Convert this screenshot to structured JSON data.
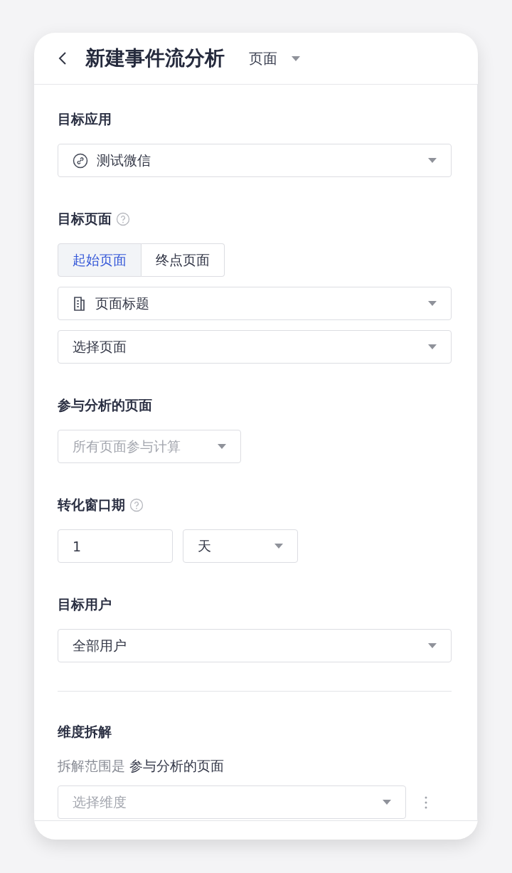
{
  "header": {
    "title": "新建事件流分析",
    "mode": "页面"
  },
  "sections": [
    {
      "label": "目标应用",
      "help": false,
      "rows": [
        [
          {
            "kind": "app",
            "value": "测试微信"
          }
        ]
      ]
    },
    {
      "label": "目标页面",
      "help": true,
      "tabs": [
        {
          "label": "起始页面",
          "selected": true
        },
        {
          "label": "终点页面",
          "selected": false
        }
      ],
      "rows": [
        [
          {
            "kind": "property",
            "value": "页面标题"
          }
        ],
        [
          {
            "kind": "select",
            "value": "选择页面"
          }
        ]
      ]
    },
    {
      "label": "参与分析的页面",
      "help": false,
      "rows": [
        [
          {
            "kind": "short-select",
            "placeholder": "所有页面参与计算"
          }
        ]
      ]
    },
    {
      "label": "转化窗口期",
      "help": true,
      "rows": [
        [
          {
            "kind": "input",
            "value": "1"
          },
          {
            "kind": "short-select",
            "value": "天"
          }
        ]
      ]
    },
    {
      "label": "目标用户",
      "help": false,
      "rows": [
        [
          {
            "kind": "select",
            "value": "全部用户"
          }
        ]
      ]
    }
  ],
  "breakdown": {
    "label": "维度拆解",
    "note": "拆解范围是 **参与分析的页面**",
    "field": {
      "kind": "select",
      "placeholder": "选择维度"
    }
  }
}
